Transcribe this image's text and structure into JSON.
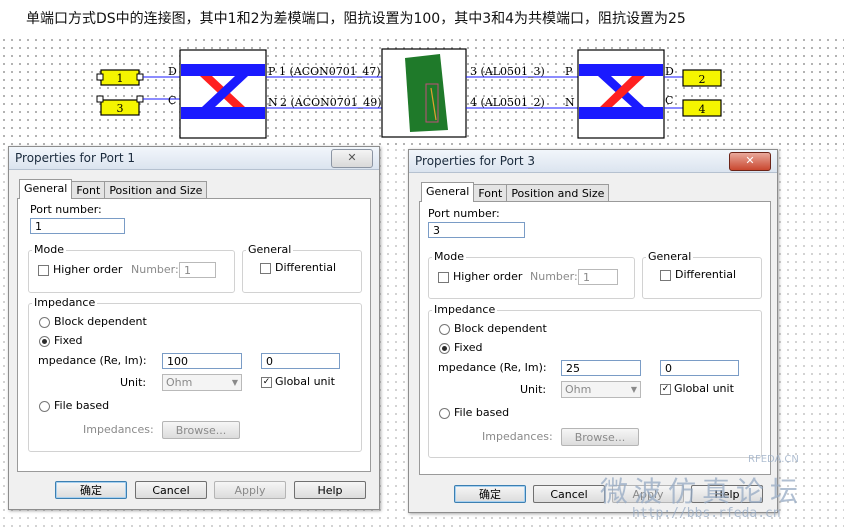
{
  "caption": "单端口方式DS中的连接图，其中1和2为差模端口，阻抗设置为100，其中3和4为共模端口，阻抗设置为25",
  "schematic": {
    "left_ports": [
      "1",
      "3"
    ],
    "right_ports": [
      "2",
      "4"
    ],
    "left_block_pins": {
      "top": "D",
      "bottom": "C"
    },
    "left_block_out": {
      "top": "P",
      "bottom": "N"
    },
    "right_block_pins": {
      "top": "P",
      "bottom": "N"
    },
    "right_block_out": {
      "top": "D",
      "bottom": "C"
    },
    "net_labels": {
      "p1": "1 (ACON0701_47)",
      "n2": "2 (ACON0701_49)",
      "p3": "3 (AL0501_3)",
      "n4": "4 (AL0501_2)"
    },
    "colors": {
      "port_fill": "#f5f500",
      "diff_fill": "#1a1aff",
      "cross_red": "#ff2020",
      "board": "#1f7a2a"
    }
  },
  "dialogs": [
    {
      "title": "Properties for Port 1",
      "tabs": [
        "General",
        "Font",
        "Position and Size"
      ],
      "port_number_label": "Port number:",
      "port_number": "1",
      "mode_title": "Mode",
      "higher_order": "Higher order",
      "number_label": "Number:",
      "number_value": "1",
      "general_title": "General",
      "differential": "Differential",
      "impedance_title": "Impedance",
      "block_dependent": "Block dependent",
      "fixed": "Fixed",
      "impedance_label": "mpedance (Re, Im):",
      "re": "100",
      "im": "0",
      "unit_label": "Unit:",
      "unit_value": "Ohm",
      "global_unit": "Global unit",
      "file_based": "File based",
      "impedances_label": "Impedances:",
      "browse": "Browse...",
      "ok": "确定",
      "cancel": "Cancel",
      "apply": "Apply",
      "help": "Help"
    },
    {
      "title": "Properties for Port 3",
      "tabs": [
        "General",
        "Font",
        "Position and Size"
      ],
      "port_number_label": "Port number:",
      "port_number": "3",
      "mode_title": "Mode",
      "higher_order": "Higher order",
      "number_label": "Number:",
      "number_value": "1",
      "general_title": "General",
      "differential": "Differential",
      "impedance_title": "Impedance",
      "block_dependent": "Block dependent",
      "fixed": "Fixed",
      "impedance_label": "mpedance (Re, Im):",
      "re": "25",
      "im": "0",
      "unit_label": "Unit:",
      "unit_value": "Ohm",
      "global_unit": "Global unit",
      "file_based": "File based",
      "impedances_label": "Impedances:",
      "browse": "Browse...",
      "ok": "确定",
      "cancel": "Cancel",
      "apply": "Apply",
      "help": "Help"
    }
  ],
  "watermark": {
    "line1": "微波仿真论坛",
    "line2": "http://bbs.rfeda.cn",
    "small": "RFEDA.CN"
  }
}
